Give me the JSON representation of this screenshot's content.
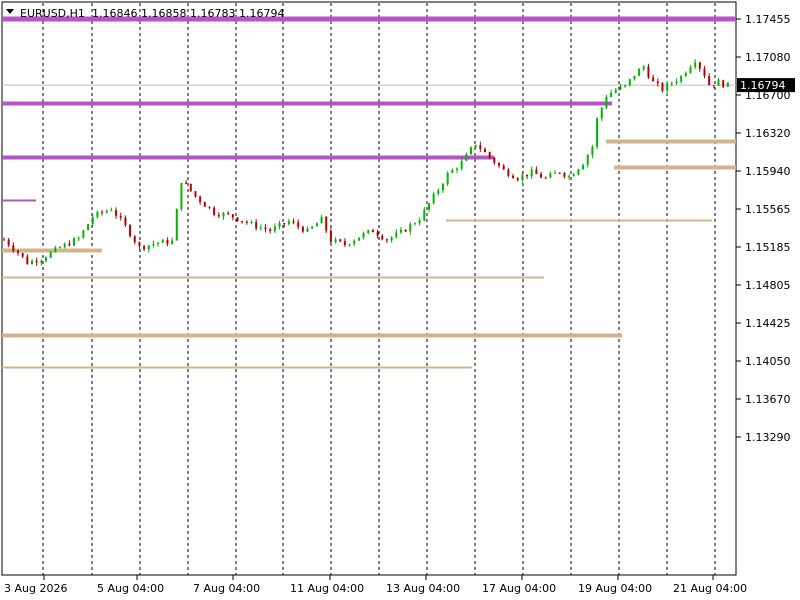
{
  "header": {
    "symbol": "EURUSD,H1",
    "ohlc": "1.16846 1.16858 1.16783 1.16794"
  },
  "chart_data": {
    "type": "candlestick",
    "symbol": "EURUSD",
    "timeframe": "H1",
    "last": {
      "open": 1.16846,
      "high": 1.16858,
      "low": 1.16783,
      "close": 1.16794
    },
    "current_price_label": "1.16794",
    "current_price": 1.16794,
    "y_ticks": [
      1.17455,
      1.1708,
      1.167,
      1.1632,
      1.1594,
      1.15565,
      1.15185,
      1.14805,
      1.14425,
      1.1405,
      1.1367,
      1.1329
    ],
    "y_tick_labels": [
      "1.17455",
      "1.17080",
      "1.16700",
      "1.16320",
      "1.15940",
      "1.15565",
      "1.15185",
      "1.14805",
      "1.14425",
      "1.14050",
      "1.13670",
      "1.13290"
    ],
    "x_labels": [
      "3 Aug 2026",
      "5 Aug 04:00",
      "7 Aug 04:00",
      "11 Aug 04:00",
      "13 Aug 04:00",
      "17 Aug 04:00",
      "19 Aug 04:00",
      "21 Aug 04:00"
    ],
    "grid": "vertical dashed",
    "colors": {
      "up": "#00b400",
      "down": "#b40000",
      "resistance": "#b653c9",
      "support": "#d2b48c",
      "current_line": "#bdbdbd"
    },
    "price_path": [
      [
        0,
        1.1525
      ],
      [
        3,
        1.1512
      ],
      [
        5,
        1.1502
      ],
      [
        8,
        1.1506
      ],
      [
        12,
        1.1517
      ],
      [
        16,
        1.1526
      ],
      [
        19,
        1.1548
      ],
      [
        23,
        1.1556
      ],
      [
        26,
        1.1538
      ],
      [
        29,
        1.1517
      ],
      [
        33,
        1.1522
      ],
      [
        36,
        1.1523
      ],
      [
        38,
        1.1584
      ],
      [
        41,
        1.1568
      ],
      [
        45,
        1.1552
      ],
      [
        49,
        1.1548
      ],
      [
        53,
        1.154
      ],
      [
        57,
        1.1534
      ],
      [
        61,
        1.1543
      ],
      [
        65,
        1.1533
      ],
      [
        68,
        1.1545
      ],
      [
        70,
        1.1524
      ],
      [
        73,
        1.152
      ],
      [
        76,
        1.1528
      ],
      [
        79,
        1.1534
      ],
      [
        82,
        1.1525
      ],
      [
        85,
        1.1532
      ],
      [
        89,
        1.1546
      ],
      [
        92,
        1.1568
      ],
      [
        95,
        1.159
      ],
      [
        98,
        1.1602
      ],
      [
        101,
        1.1621
      ],
      [
        104,
        1.1607
      ],
      [
        107,
        1.1594
      ],
      [
        110,
        1.1587
      ],
      [
        113,
        1.1592
      ],
      [
        116,
        1.1586
      ],
      [
        119,
        1.1593
      ],
      [
        121,
        1.1588
      ],
      [
        124,
        1.1602
      ],
      [
        126,
        1.1618
      ],
      [
        127,
        1.1645
      ],
      [
        129,
        1.1669
      ],
      [
        131,
        1.1675
      ],
      [
        133,
        1.1678
      ],
      [
        135,
        1.169
      ],
      [
        137,
        1.1698
      ],
      [
        139,
        1.1682
      ],
      [
        141,
        1.1675
      ],
      [
        143,
        1.1682
      ],
      [
        145,
        1.1688
      ],
      [
        147,
        1.17
      ],
      [
        148,
        1.1705
      ],
      [
        150,
        1.169
      ],
      [
        151,
        1.168
      ],
      [
        153,
        1.1682
      ],
      [
        155,
        1.1679
      ]
    ],
    "resistance_levels": [
      1.17455,
      1.1661,
      1.1607,
      1.1564
    ],
    "support_levels": [
      1.1514,
      1.1487,
      1.1429,
      1.1397,
      1.1623,
      1.1597,
      1.1544
    ]
  }
}
